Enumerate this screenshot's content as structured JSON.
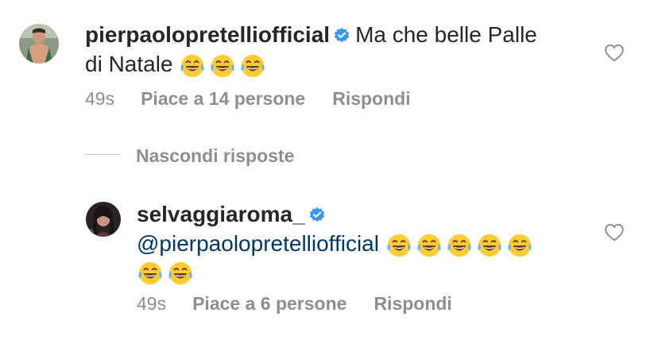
{
  "comment": {
    "username": "pierpaolopretelliofficial",
    "text_line1": "Ma che belle Palle",
    "text_line2": "di Natale",
    "emoji_count": 3,
    "time": "49s",
    "likes_label": "Piace a 14 persone",
    "reply_label": "Rispondi"
  },
  "hide_replies_label": "Nascondi risposte",
  "reply": {
    "username": "selvaggiaroma_",
    "mention": "@pierpaolopretelliofficial",
    "emoji_line1_count": 5,
    "emoji_line2_count": 2,
    "time": "49s",
    "likes_label": "Piace a 6 persone",
    "reply_label": "Rispondi"
  },
  "colors": {
    "text": "#262626",
    "secondary": "#8e8e8e",
    "mention": "#00376b",
    "verified": "#3897f0"
  },
  "icons": [
    "verified-badge-icon",
    "heart-icon",
    "laughing-emoji-icon"
  ]
}
